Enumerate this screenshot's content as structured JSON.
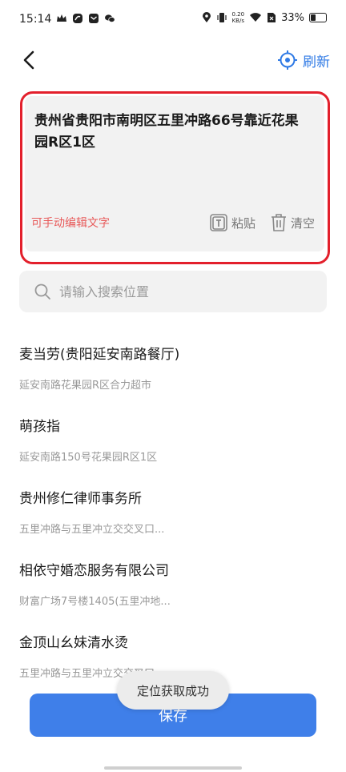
{
  "status_bar": {
    "time": "15:14",
    "net_speed_value": "0.20",
    "net_speed_unit": "KB/s",
    "battery": "33%"
  },
  "nav": {
    "back_icon": "chevron-left-icon",
    "refresh_label": "刷新",
    "refresh_icon": "locate-crosshair-icon"
  },
  "address_box": {
    "text": "贵州省贵阳市南明区五里冲路66号靠近花果园R区1区",
    "hint": "可手动编辑文字",
    "paste_label": "粘贴",
    "clear_label": "清空"
  },
  "search": {
    "placeholder": "请输入搜索位置"
  },
  "poi_list": [
    {
      "name": "麦当劳(贵阳延安南路餐厅)",
      "address": "延安南路花果园R区合力超市"
    },
    {
      "name": "萌孩指",
      "address": "延安南路150号花果园R区1区"
    },
    {
      "name": "贵州修仁律师事务所",
      "address": "五里冲路与五里冲立交交叉口..."
    },
    {
      "name": "相依守婚恋服务有限公司",
      "address": "财富广场7号楼1405(五里冲地..."
    },
    {
      "name": "金顶山幺妹清水烫",
      "address": "五里冲路与五里冲立交交叉口..."
    }
  ],
  "save_label": "保存",
  "toast": "定位获取成功",
  "colors": {
    "accent": "#3f7fe9",
    "highlight_border": "#e3202c",
    "hint": "#e85a5a"
  }
}
